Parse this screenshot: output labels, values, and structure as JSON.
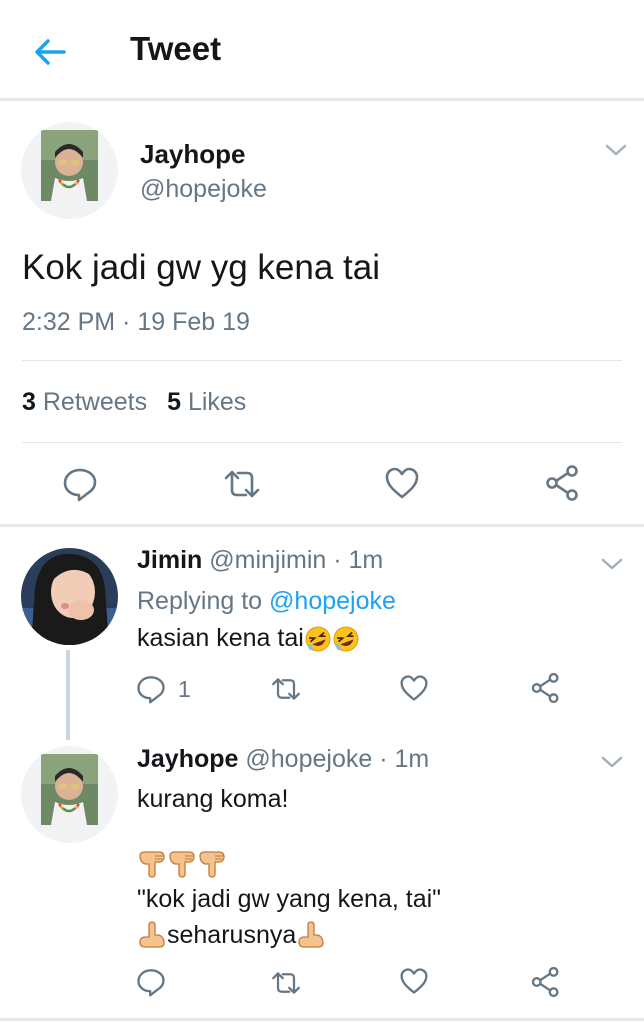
{
  "header": {
    "title": "Tweet",
    "back_icon": "arrow-left-icon",
    "accent": "#1da1f2"
  },
  "main_tweet": {
    "name": "Jayhope",
    "handle": "@hopejoke",
    "text": "Kok jadi gw yg kena tai",
    "time": "2:32 PM · 19 Feb 19",
    "retweets_count": "3",
    "retweets_label": "Retweets",
    "likes_count": "5",
    "likes_label": "Likes"
  },
  "replies": [
    {
      "name": "Jimin",
      "meta": "@minjimin · 1m",
      "replying_prefix": "Replying to",
      "replying_handle": "@hopejoke",
      "text": "kasian kena tai",
      "reply_count": "1"
    },
    {
      "name": "Jayhope",
      "meta": "@hopejoke · 1m",
      "line1": "kurang koma!",
      "line3": "\"kok jadi gw yang kena, tai\"",
      "line4": "seharusnya"
    }
  ],
  "colors": {
    "text": "#14171a",
    "secondary": "#657786",
    "link": "#1da1f2",
    "divider": "#e1e8ed"
  }
}
